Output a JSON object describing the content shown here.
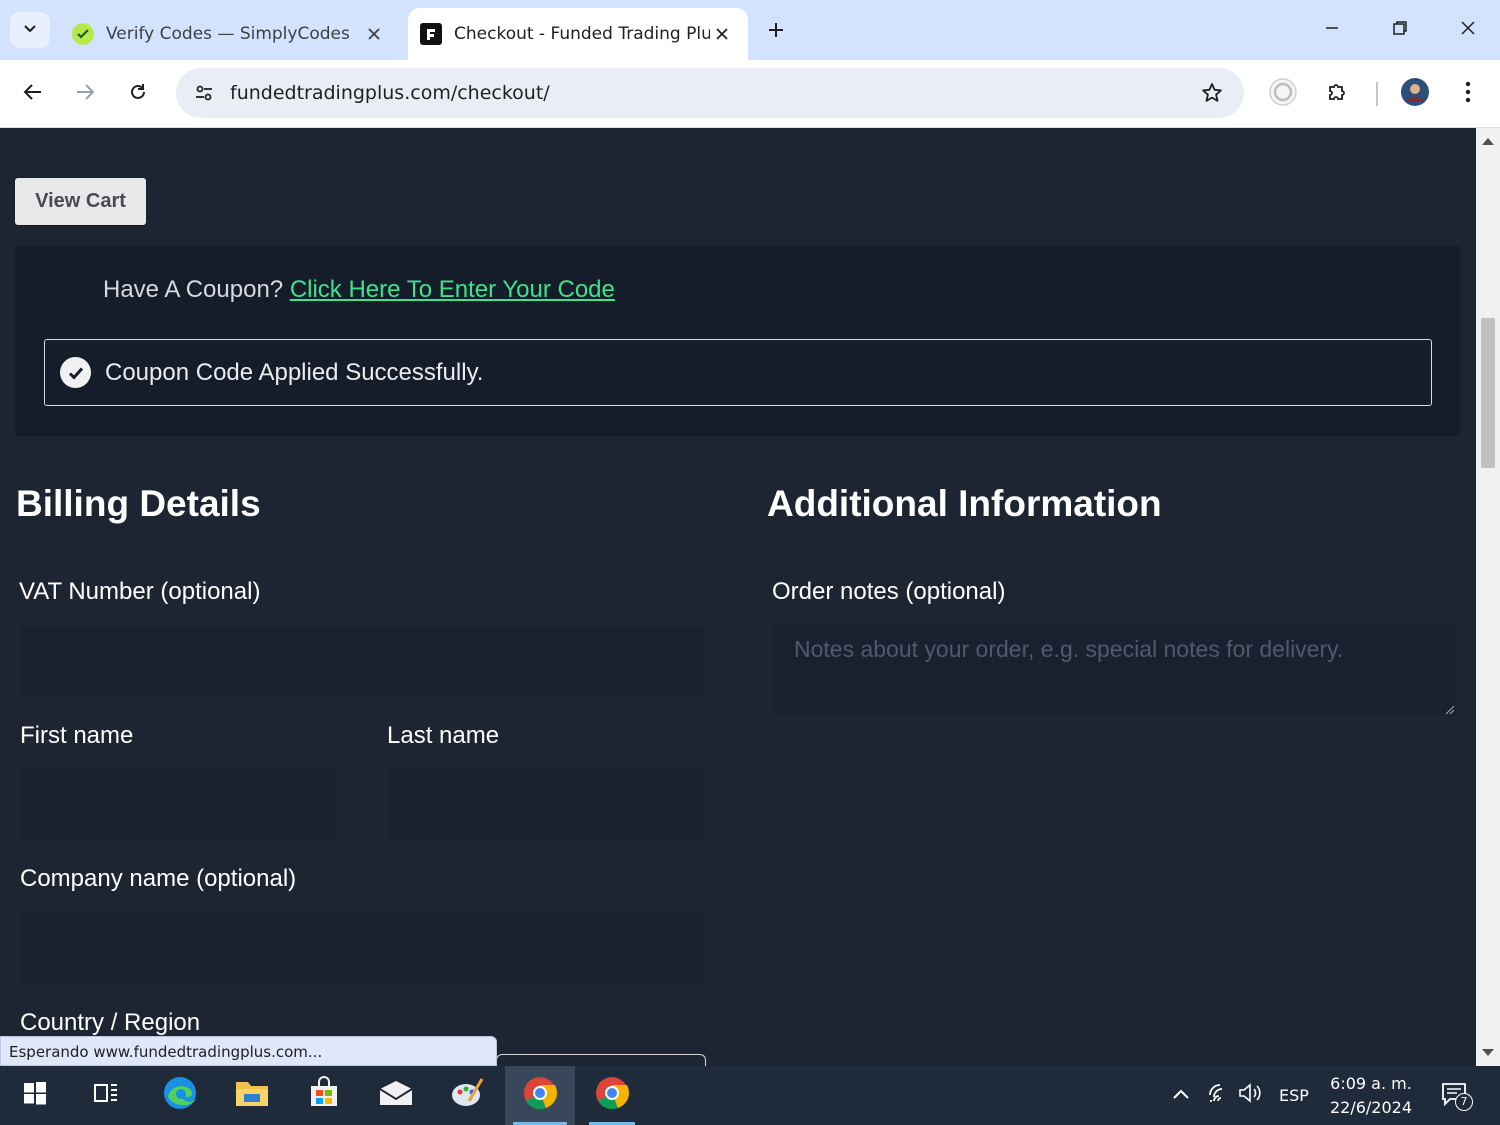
{
  "browser": {
    "tabs": [
      {
        "title": "Verify Codes — SimplyCodes",
        "active": false
      },
      {
        "title": "Checkout - Funded Trading Plus",
        "active": true
      }
    ],
    "url": "fundedtradingplus.com/checkout/",
    "status_text": "Esperando www.fundedtradingplus.com..."
  },
  "page": {
    "view_cart_label": "View Cart",
    "coupon_prompt": "Have A Coupon?",
    "coupon_link": "Click Here To Enter Your Code",
    "coupon_success": "Coupon Code Applied Successfully.",
    "billing": {
      "heading": "Billing Details",
      "vat_label": "VAT Number (optional)",
      "first_name_label": "First name",
      "last_name_label": "Last name",
      "company_label": "Company name (optional)",
      "country_label": "Country / Region"
    },
    "additional": {
      "heading": "Additional Information",
      "notes_label": "Order notes (optional)",
      "notes_placeholder": "Notes about your order, e.g. special notes for delivery."
    }
  },
  "taskbar": {
    "language": "ESP",
    "time": "6:09 a. m.",
    "date": "22/6/2024",
    "notification_count": "7"
  },
  "colors": {
    "page_bg": "#1d2533",
    "panel_bg": "#161d2a",
    "input_bg": "#182130",
    "link": "#3ee28b",
    "tabstrip": "#d3e3fd"
  }
}
